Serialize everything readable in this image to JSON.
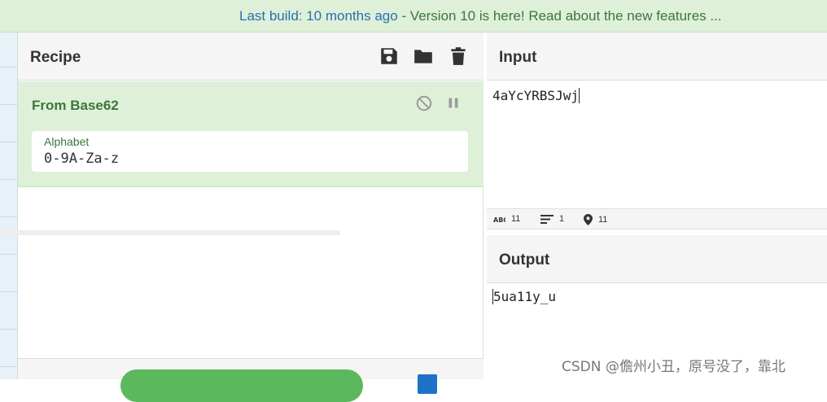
{
  "banner": {
    "link_text": "Last build: 10 months ago",
    "rest_text": " - Version 10 is here! Read about the new features ..."
  },
  "recipe": {
    "title": "Recipe",
    "header_icons": [
      "save-icon",
      "folder-icon",
      "trash-icon"
    ],
    "operation": {
      "name": "From Base62",
      "icons": [
        "disable-icon",
        "pause-icon"
      ],
      "arg_label": "Alphabet",
      "arg_value": "0-9A-Za-z"
    }
  },
  "input": {
    "title": "Input",
    "text": "4aYcYRBSJwj",
    "status": {
      "length": "11",
      "lines": "1",
      "position": "11"
    }
  },
  "output": {
    "title": "Output",
    "text": "5ua11y_u"
  },
  "watermark": "CSDN @儋州小丑，原号没了，靠北",
  "colors": {
    "accent_green": "#3c763d",
    "banner_bg": "#dff0d8",
    "bake_button": "#5cb85c",
    "link_blue": "#2a6fb0"
  }
}
